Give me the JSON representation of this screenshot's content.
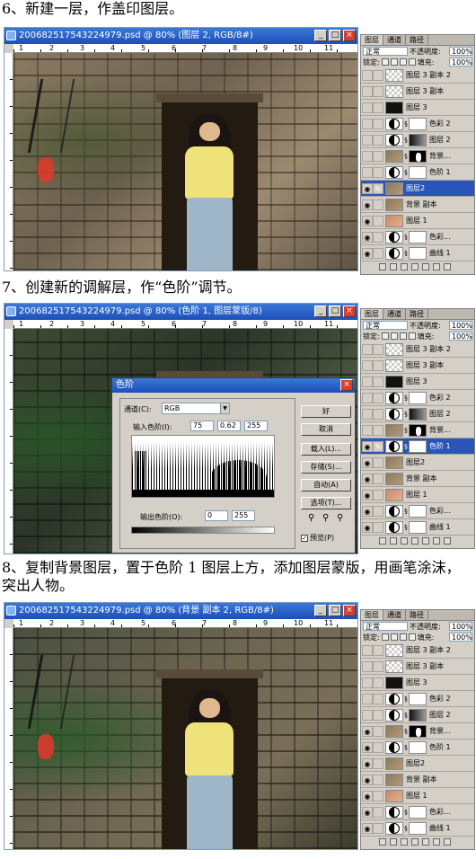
{
  "steps": [
    {
      "heading": "6、新建一层，作盖印图层。",
      "window_title": "20068251754322​4979.psd @ 80% (图层 2, RGB/8#)",
      "ruler_numbers": [
        "1",
        "2",
        "3",
        "4",
        "5",
        "6",
        "7",
        "8",
        "9",
        "10",
        "11"
      ],
      "panel": {
        "tabs": [
          "图层",
          "通道",
          "路径"
        ],
        "blend_mode": "正常",
        "opacity_label": "不透明度:",
        "opacity": "100%",
        "lock_label": "锁定:",
        "fill_label": "填充:",
        "fill": "100%",
        "layers": [
          {
            "name": "图层 3 副本 2",
            "thumb": "trans",
            "mask": "",
            "visible": false,
            "selected": false
          },
          {
            "name": "图层 3 副本",
            "thumb": "trans",
            "mask": "",
            "visible": false,
            "selected": false
          },
          {
            "name": "图层 3",
            "thumb": "mask-blk",
            "mask": "",
            "visible": false,
            "selected": false
          },
          {
            "name": "色彩 2",
            "thumb": "adj",
            "mask": "mask-w",
            "visible": false,
            "selected": false
          },
          {
            "name": "图层 2",
            "thumb": "adj",
            "mask": "mask-d",
            "visible": false,
            "selected": false
          },
          {
            "name": "背景...",
            "thumb": "photo-t",
            "mask": "mask",
            "visible": false,
            "selected": false
          },
          {
            "name": "色阶 1",
            "thumb": "adj",
            "mask": "mask-w",
            "visible": false,
            "selected": false
          },
          {
            "name": "图层2",
            "thumb": "photo-t",
            "mask": "",
            "visible": true,
            "selected": true
          },
          {
            "name": "背景 副本",
            "thumb": "photo-t",
            "mask": "",
            "visible": true,
            "selected": false
          },
          {
            "name": "图层 1",
            "thumb": "photo-c",
            "mask": "",
            "visible": true,
            "selected": false
          },
          {
            "name": "色彩...",
            "thumb": "adj",
            "mask": "mask-w",
            "visible": true,
            "selected": false
          },
          {
            "name": "曲线 1",
            "thumb": "adj",
            "mask": "mask-w",
            "visible": true,
            "selected": false
          }
        ]
      }
    },
    {
      "heading": "7、创建新的调解层，作“色阶”调节。",
      "window_title": "20068251754322​4979.psd @ 80% (色阶 1, 图层蒙版/8)",
      "ruler_numbers": [
        "1",
        "2",
        "3",
        "4",
        "5",
        "6",
        "7",
        "8",
        "9",
        "10",
        "11"
      ],
      "panel": {
        "tabs": [
          "图层",
          "通道",
          "路径"
        ],
        "blend_mode": "正常",
        "opacity_label": "不透明度:",
        "opacity": "100%",
        "lock_label": "锁定:",
        "fill_label": "填充:",
        "fill": "100%",
        "layers": [
          {
            "name": "图层 3 副本 2",
            "thumb": "trans",
            "mask": "",
            "visible": false,
            "selected": false
          },
          {
            "name": "图层 3 副本",
            "thumb": "trans",
            "mask": "",
            "visible": false,
            "selected": false
          },
          {
            "name": "图层 3",
            "thumb": "mask-blk",
            "mask": "",
            "visible": false,
            "selected": false
          },
          {
            "name": "色彩 2",
            "thumb": "adj",
            "mask": "mask-w",
            "visible": false,
            "selected": false
          },
          {
            "name": "图层 2",
            "thumb": "adj",
            "mask": "mask-d",
            "visible": false,
            "selected": false
          },
          {
            "name": "背景...",
            "thumb": "photo-t",
            "mask": "mask",
            "visible": false,
            "selected": false
          },
          {
            "name": "色阶 1",
            "thumb": "adj",
            "mask": "mask-w",
            "visible": true,
            "selected": true
          },
          {
            "name": "图层2",
            "thumb": "photo-t",
            "mask": "",
            "visible": true,
            "selected": false
          },
          {
            "name": "背景 副本",
            "thumb": "photo-t",
            "mask": "",
            "visible": true,
            "selected": false
          },
          {
            "name": "图层 1",
            "thumb": "photo-c",
            "mask": "",
            "visible": true,
            "selected": false
          },
          {
            "name": "色彩...",
            "thumb": "adj",
            "mask": "mask-w",
            "visible": true,
            "selected": false
          },
          {
            "name": "曲线 1",
            "thumb": "adj",
            "mask": "mask-w",
            "visible": true,
            "selected": false
          }
        ]
      },
      "levels_dialog": {
        "title": "色阶",
        "channel_label": "通道(C):",
        "channel": "RGB",
        "input_label": "输入色阶(I):",
        "input_values": [
          "75",
          "0.62",
          "255"
        ],
        "output_label": "输出色阶(O):",
        "output_values": [
          "0",
          "255"
        ],
        "buttons": [
          "好",
          "取消",
          "载入(L)...",
          "存储(S)...",
          "自动(A)",
          "选项(T)..."
        ],
        "preview_label": "预览(P)"
      }
    },
    {
      "heading": "8、复制背景图层，置于色阶 1 图层上方，添加图层蒙版，用画笔涂沫，突出人物。",
      "window_title": "20068251754322​4979.psd @ 80% (背景 副本 2, RGB/8#)",
      "ruler_numbers": [
        "1",
        "2",
        "3",
        "4",
        "5",
        "6",
        "7",
        "8",
        "9",
        "10",
        "11"
      ],
      "panel": {
        "tabs": [
          "图层",
          "通道",
          "路径"
        ],
        "blend_mode": "正常",
        "opacity_label": "不透明度:",
        "opacity": "100%",
        "lock_label": "锁定:",
        "fill_label": "填充:",
        "fill": "100%",
        "layers": [
          {
            "name": "图层 3 副本 2",
            "thumb": "trans",
            "mask": "",
            "visible": false,
            "selected": false
          },
          {
            "name": "图层 3 副本",
            "thumb": "trans",
            "mask": "",
            "visible": false,
            "selected": false
          },
          {
            "name": "图层 3",
            "thumb": "mask-blk",
            "mask": "",
            "visible": false,
            "selected": false
          },
          {
            "name": "色彩 2",
            "thumb": "adj",
            "mask": "mask-w",
            "visible": false,
            "selected": false
          },
          {
            "name": "图层 2",
            "thumb": "adj",
            "mask": "mask-d",
            "visible": false,
            "selected": false
          },
          {
            "name": "背景...",
            "thumb": "photo-t",
            "mask": "mask",
            "visible": true,
            "selected": false
          },
          {
            "name": "色阶 1",
            "thumb": "adj",
            "mask": "mask-w",
            "visible": true,
            "selected": false
          },
          {
            "name": "图层2",
            "thumb": "photo-t",
            "mask": "",
            "visible": true,
            "selected": false
          },
          {
            "name": "背景 副本",
            "thumb": "photo-t",
            "mask": "",
            "visible": true,
            "selected": false
          },
          {
            "name": "图层 1",
            "thumb": "photo-c",
            "mask": "",
            "visible": true,
            "selected": false
          },
          {
            "name": "色彩...",
            "thumb": "adj",
            "mask": "mask-w",
            "visible": true,
            "selected": false
          },
          {
            "name": "曲线 1",
            "thumb": "adj",
            "mask": "mask-w",
            "visible": true,
            "selected": false
          }
        ]
      }
    }
  ],
  "colors": {
    "selection": "#2a55b8",
    "titlebar": "#1c4fb8",
    "seal": "#d83a2c"
  },
  "icons": {
    "eye": "eye-icon",
    "brush": "brush-icon",
    "close": "close-icon"
  }
}
